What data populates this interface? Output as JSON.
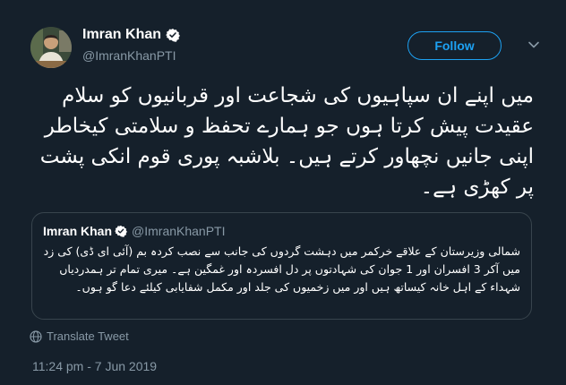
{
  "user": {
    "name": "Imran Khan",
    "handle": "@ImranKhanPTI"
  },
  "follow_label": "Follow",
  "tweet_text": "میں اپنے ان سپاہیوں کی شجاعت اور قربانیوں کو سلام عقیدت پیش کرتا ہوں جو ہمارے تحفظ و سلامتی کیخاطر اپنی جانیں نچھاور کرتے ہیں۔ بلاشبہ پوری قوم انکی پشت پر کھڑی ہے۔",
  "quoted_tweet": {
    "name": "Imran Khan",
    "handle": "@ImranKhanPTI",
    "text": "شمالی وزیرستان کے علاقے خرکمر میں دہشت گردوں کی جانب سے نصب کردہ بم (آئی ای ڈی) کی زد میں آکر 3 افسران اور 1 جوان کی شہادتوں پر دل افسردہ اور غمگین ہے۔ میری تمام تر ہمدردیاں شہداء کے اہل خانہ کیساتھ ہیں اور میں زخمیوں کی جلد اور مکمل شفایابی کیلئے دعا گو ہوں۔"
  },
  "translate_label": "Translate Tweet",
  "timestamp": "11:24 pm - 7 Jun 2019",
  "colors": {
    "background": "#15202b",
    "accent": "#1da1f2",
    "secondary_text": "#8899a6",
    "border": "#38444d",
    "verified_badge": "#ffffff"
  },
  "icons": {
    "verified": "verified-badge-icon",
    "chevron": "chevron-down-icon",
    "translate": "globe-icon"
  }
}
